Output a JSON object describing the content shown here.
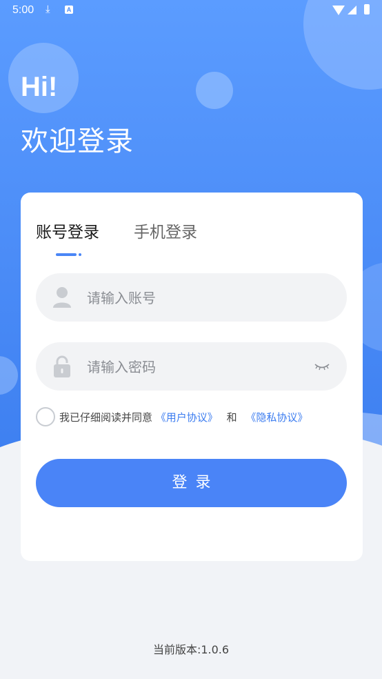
{
  "status_bar": {
    "time": "5:00",
    "icons": [
      "download-icon",
      "a-notification-icon",
      "wifi-icon",
      "signal-icon",
      "battery-icon"
    ]
  },
  "hero": {
    "greeting": "Hi!",
    "welcome": "欢迎登录"
  },
  "tabs": [
    {
      "label": "账号登录",
      "active": true
    },
    {
      "label": "手机登录",
      "active": false
    }
  ],
  "account_field": {
    "placeholder": "请输入账号",
    "value": "",
    "icon": "user-icon"
  },
  "password_field": {
    "placeholder": "请输入密码",
    "value": "",
    "icon": "lock-icon",
    "toggle_icon": "eye-closed-icon"
  },
  "agreement": {
    "checked": false,
    "prefix": "我已仔细阅读并同意",
    "user_agreement": "《用户协议》",
    "and": "和",
    "privacy_policy": "《隐私协议》"
  },
  "login_button": {
    "label": "登录"
  },
  "version": "当前版本:1.0.6",
  "colors": {
    "primary": "#4a84f7",
    "link": "#3b7cf0",
    "background": "#f1f3f7",
    "input_bg": "#f2f3f5"
  }
}
